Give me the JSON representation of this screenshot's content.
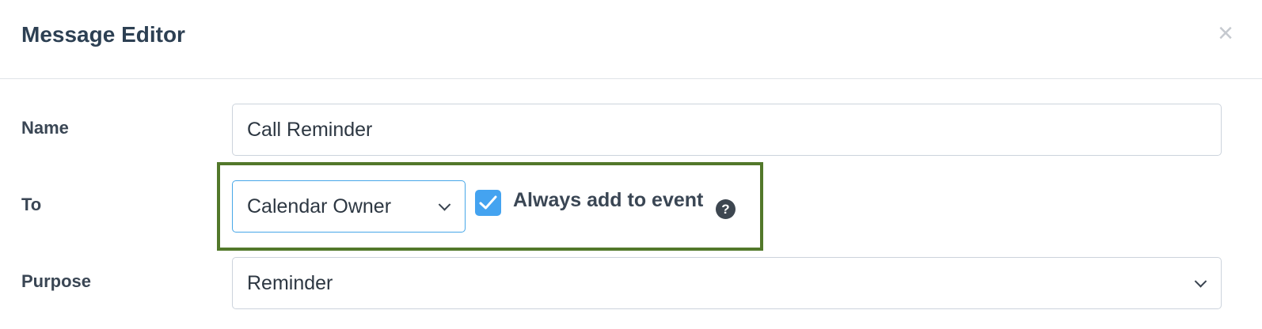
{
  "dialog": {
    "title": "Message Editor",
    "close_glyph": "×"
  },
  "form": {
    "name": {
      "label": "Name",
      "value": "Call Reminder"
    },
    "to": {
      "label": "To",
      "selected": "Calendar Owner",
      "always_add": {
        "label": "Always add to event",
        "checked": true
      },
      "help_glyph": "?"
    },
    "purpose": {
      "label": "Purpose",
      "selected": "Reminder"
    }
  },
  "colors": {
    "accent": "#44a3f0",
    "highlight_border": "#52782a",
    "title_text": "#2d4053"
  },
  "icons": [
    "close-icon",
    "chevron-down-icon",
    "check-icon",
    "help-icon"
  ]
}
